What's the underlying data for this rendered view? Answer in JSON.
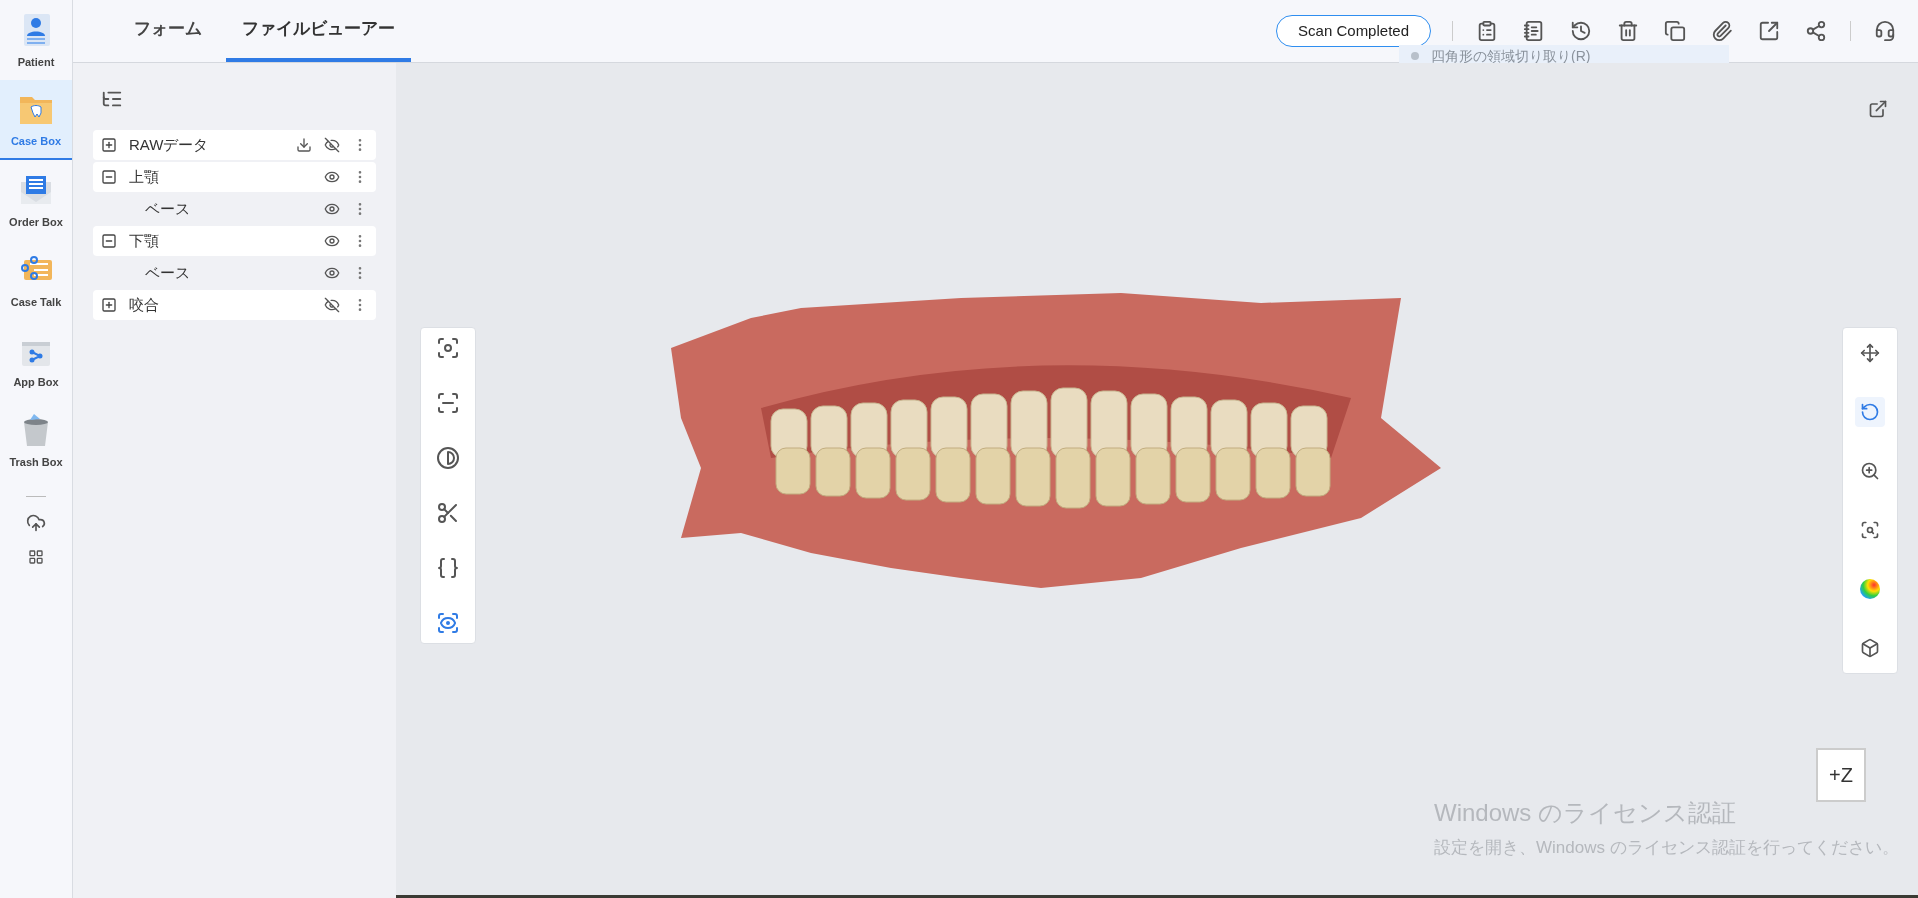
{
  "sidebar": {
    "items": [
      {
        "kind": "patient",
        "label": "Patient",
        "selected": false
      },
      {
        "kind": "case",
        "label": "Case Box",
        "selected": true
      },
      {
        "kind": "order",
        "label": "Order Box",
        "selected": false
      },
      {
        "kind": "talk",
        "label": "Case Talk",
        "selected": false
      },
      {
        "kind": "app",
        "label": "App Box",
        "selected": false
      },
      {
        "kind": "trash",
        "label": "Trash Box",
        "selected": false
      }
    ]
  },
  "tabs": [
    {
      "label": "フォーム",
      "selected": false
    },
    {
      "label": "ファイルビューアー",
      "selected": true
    }
  ],
  "status_button": "Scan Completed",
  "tooltip": "四角形の領域切り取り(R)",
  "tree": [
    {
      "name": "RAWデータ",
      "expanded": false,
      "visible": false,
      "download": true
    },
    {
      "name": "上顎",
      "expanded": true,
      "visible": true,
      "download": false,
      "children": [
        {
          "name": "ベース",
          "visible": true
        }
      ]
    },
    {
      "name": "下顎",
      "expanded": true,
      "visible": true,
      "download": false,
      "children": [
        {
          "name": "ベース",
          "visible": true
        }
      ]
    },
    {
      "name": "咬合",
      "expanded": false,
      "visible": false,
      "download": false
    }
  ],
  "view_tools": [
    {
      "kind": "move",
      "selected": false
    },
    {
      "kind": "rotate",
      "selected": true
    },
    {
      "kind": "zoom",
      "selected": false
    },
    {
      "kind": "fit",
      "selected": false
    },
    {
      "kind": "color",
      "selected": false
    },
    {
      "kind": "cube",
      "selected": false
    }
  ],
  "axis_button": "+Z",
  "windows_notice": {
    "title": "Windows のライセンス認証",
    "message": "設定を開き、Windows のライセンス認証を行ってください。"
  }
}
